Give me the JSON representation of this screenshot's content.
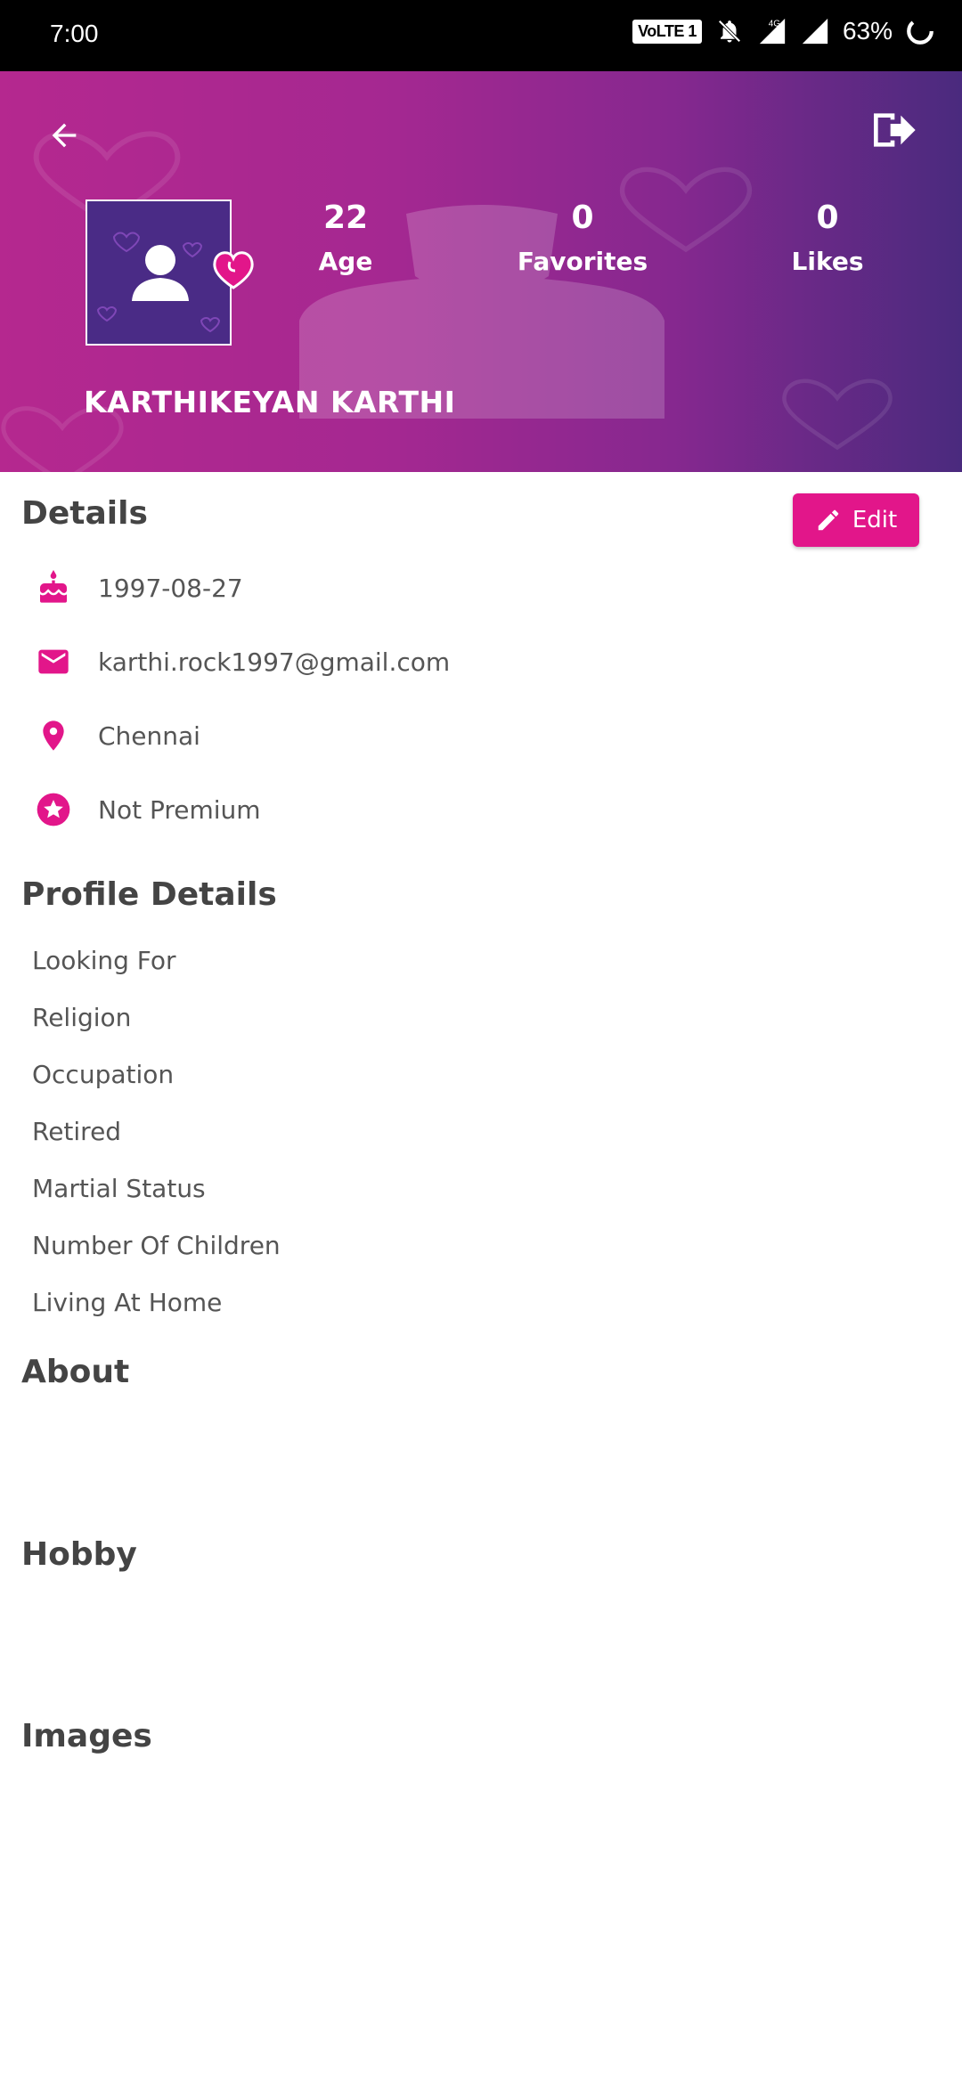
{
  "status_bar": {
    "time": "7:00",
    "network_badge": "VoLTE 1",
    "network_type": "4G",
    "battery": "63%",
    "icons": [
      "bell-off-icon",
      "signal-icon",
      "signal-icon",
      "battery-ring-icon"
    ]
  },
  "header": {
    "back_icon": "arrow-left-icon",
    "logout_icon": "logout-icon",
    "avatar_icon": "person-icon",
    "badge_icon": "heart-icon",
    "stats": [
      {
        "value": "22",
        "label": "Age"
      },
      {
        "value": "0",
        "label": "Favorites"
      },
      {
        "value": "0",
        "label": "Likes"
      }
    ],
    "name": "KARTHIKEYAN KARTHI"
  },
  "details": {
    "title": "Details",
    "edit_label": "Edit",
    "items": [
      {
        "icon": "cake-icon",
        "text": "1997-08-27"
      },
      {
        "icon": "mail-icon",
        "text": "karthi.rock1997@gmail.com"
      },
      {
        "icon": "location-pin-icon",
        "text": "Chennai"
      },
      {
        "icon": "star-badge-icon",
        "text": "Not Premium"
      }
    ]
  },
  "profile_details": {
    "title": "Profile Details",
    "items": [
      "Looking For",
      "Religion",
      "Occupation",
      "Retired",
      "Martial Status",
      "Number Of Children",
      "Living At Home"
    ]
  },
  "about": {
    "title": "About"
  },
  "hobby": {
    "title": "Hobby"
  },
  "images": {
    "title": "Images"
  },
  "colors": {
    "accent": "#e2168a",
    "header_start": "#b5288f",
    "header_end": "#4a2a7e",
    "text": "#444444"
  }
}
